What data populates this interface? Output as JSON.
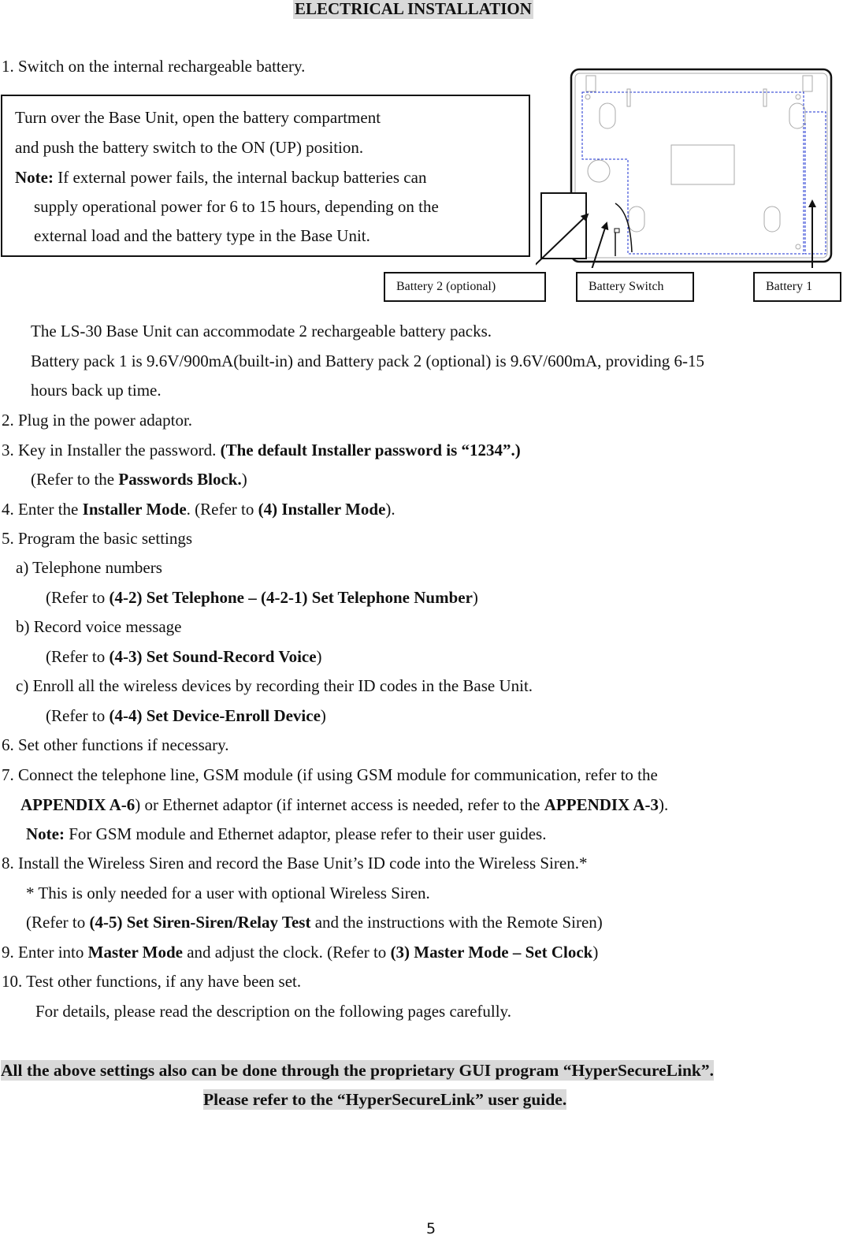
{
  "title": "ELECTRICAL INSTALLATION",
  "step1": "1. Switch on the internal rechargeable battery.",
  "note_box": {
    "line1": "Turn over the Base Unit, open the battery compartment",
    "line2": "and push the battery switch to the ON (UP) position.",
    "note_label": "Note:",
    "line3": " If external power fails, the internal backup batteries can",
    "line4": "supply operational power for 6 to 15 hours, depending on the",
    "line5": "external load and the battery type in the Base Unit."
  },
  "diagram": {
    "labels": {
      "battery2": "Battery 2 (optional)",
      "switch": "Battery Switch",
      "battery1": "Battery 1"
    },
    "colors": {
      "outline": "#111111",
      "dashed": "#1a2fd0",
      "light": "#9a9a9a"
    }
  },
  "battery_info": {
    "line1": "The LS-30 Base Unit can accommodate 2 rechargeable battery packs.",
    "line2": "Battery pack 1 is 9.6V/900mA(built-in) and Battery pack 2 (optional) is 9.6V/600mA, providing 6-15",
    "line3": "hours back up time."
  },
  "steps": {
    "s2": "2. Plug in the power adaptor.",
    "s3_a": "3. Key in Installer the password. ",
    "s3_b": "(The default Installer password is “1234”.)",
    "s3_ref_a": "(Refer to the ",
    "s3_ref_b": "Passwords Block.",
    "s3_ref_c": ")",
    "s4_a": "4. Enter the ",
    "s4_b": "Installer Mode",
    "s4_c": ". (Refer to ",
    "s4_d": "(4) Installer Mode",
    "s4_e": ").",
    "s5": "5. Program the basic settings",
    "s5a": "a) Telephone numbers",
    "s5a_ref_a": "(Refer to ",
    "s5a_ref_b": "(4-2) Set Telephone – (4-2-1) Set Telephone Number",
    "s5a_ref_c": ")",
    "s5b": "b) Record voice message",
    "s5b_ref_a": "(Refer to ",
    "s5b_ref_b": "(4-3) Set Sound-Record Voice",
    "s5b_ref_c": ")",
    "s5c": "c) Enroll all the wireless devices by recording their ID codes in the Base Unit.",
    "s5c_ref_a": "(Refer to ",
    "s5c_ref_b": "(4-4) Set Device-Enroll Device",
    "s5c_ref_c": ")",
    "s6": "6. Set other functions if necessary.",
    "s7_l1": "7. Connect the telephone line, GSM module (if using GSM module for communication, refer to the",
    "s7_l2_a": "APPENDIX A-6",
    "s7_l2_b": ") or Ethernet adaptor (if internet access is needed, refer to the ",
    "s7_l2_c": "APPENDIX A-3",
    "s7_l2_d": ").",
    "s7_note_a": "Note:",
    "s7_note_b": " For GSM module and Ethernet adaptor, please refer to their user guides.",
    "s8": "8. Install the Wireless Siren and record the Base Unit’s ID code into the Wireless Siren.*",
    "s8_star": "* This is only needed for a user with optional Wireless Siren.",
    "s8_ref_a": "(Refer to ",
    "s8_ref_b": "(4-5) Set Siren-Siren/Relay Test",
    "s8_ref_c": " and the instructions with the Remote Siren)",
    "s9_a": "9. Enter into ",
    "s9_b": "Master Mode",
    "s9_c": " and adjust the clock. (Refer to ",
    "s9_d": "(3) Master Mode – Set Clock",
    "s9_e": ")",
    "s10": "10. Test other functions, if any have been set.",
    "s10_detail": "For details, please read the description on the following pages carefully."
  },
  "footer_note": {
    "line1": "All the above settings also can be done through the proprietary GUI program “HyperSecureLink”.",
    "line2": "Please refer to the “HyperSecureLink” user guide."
  },
  "page_number": "5"
}
